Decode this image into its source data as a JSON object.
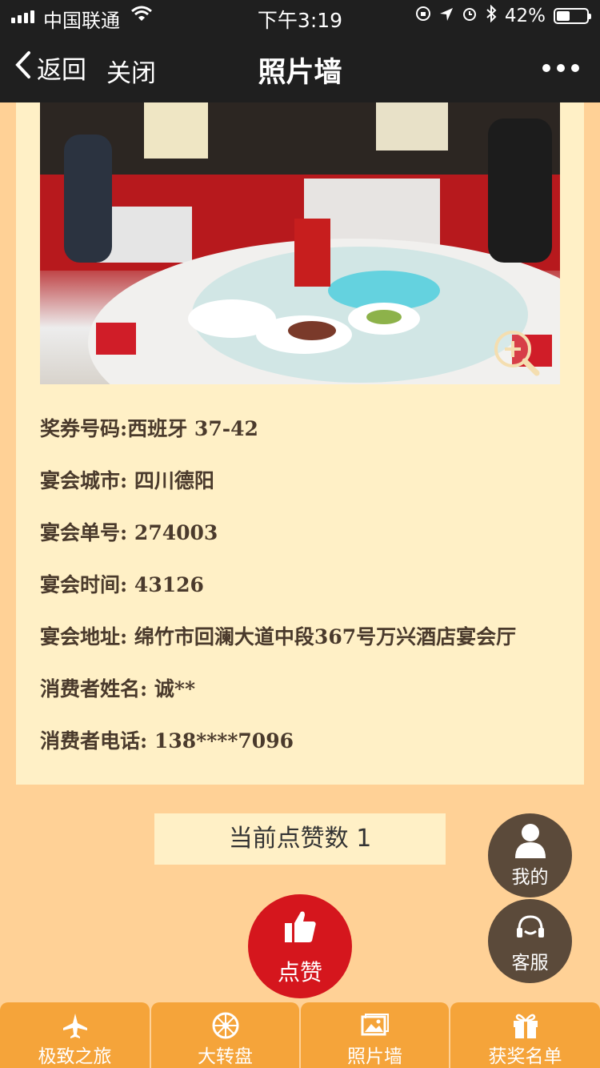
{
  "status": {
    "carrier": "中国联通",
    "time": "下午3:19",
    "battery": "42%"
  },
  "nav": {
    "back_label": "返回",
    "close_label": "关闭",
    "title": "照片墙"
  },
  "details": {
    "voucher": "奖券号码:西班牙 37-42",
    "city": "宴会城市: 四川德阳",
    "order_no": "宴会单号: 274003",
    "time": "宴会时间: 43126",
    "address": "宴会地址: 绵竹市回澜大道中段367号万兴酒店宴会厅",
    "consumer_name": "消费者姓名: 诚**",
    "consumer_phone": "消费者电话: 138****7096"
  },
  "like": {
    "count_text": "当前点赞数 1",
    "button_label": "点赞"
  },
  "floating": {
    "mine_label": "我的",
    "service_label": "客服"
  },
  "tabs": [
    {
      "label": "极致之旅",
      "icon": "airplane-icon"
    },
    {
      "label": "大转盘",
      "icon": "wheel-icon"
    },
    {
      "label": "照片墙",
      "icon": "photo-icon"
    },
    {
      "label": "获奖名单",
      "icon": "gift-icon"
    }
  ],
  "colors": {
    "background": "#ffd196",
    "card": "#fff0c6",
    "tab": "#f5a43a",
    "like_button": "#d5161d",
    "fab": "#5b4a3a"
  }
}
